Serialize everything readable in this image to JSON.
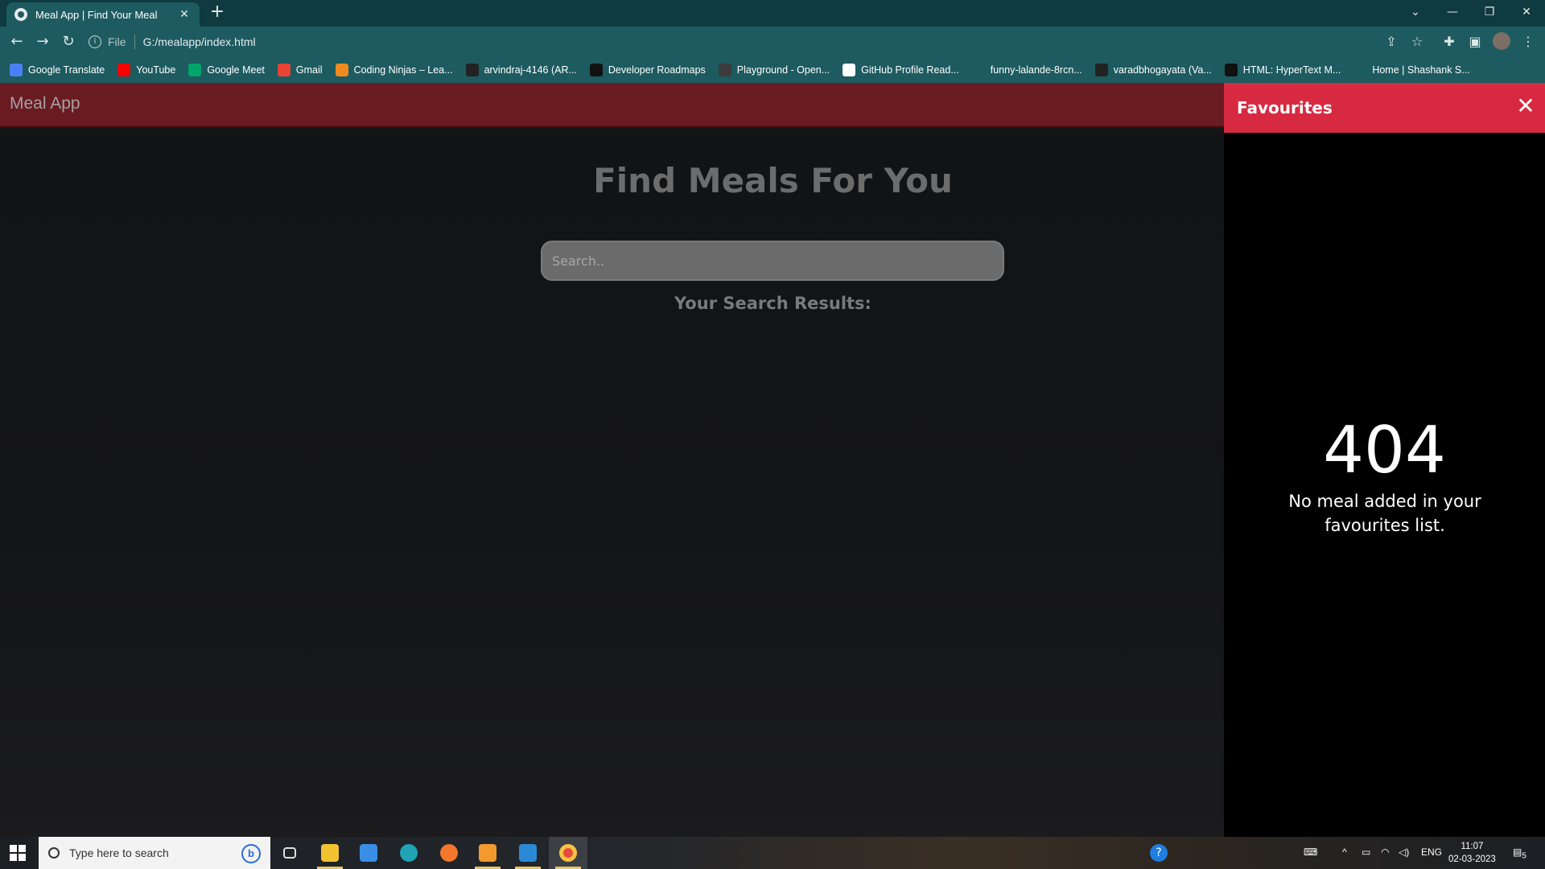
{
  "browser": {
    "tab_title": "Meal App | Find Your Meal",
    "tab_close": "✕",
    "new_tab": "+",
    "file_label": "File",
    "url": "G:/mealapp/index.html",
    "win_minimize": "—",
    "win_restore": "❐",
    "win_close": "✕",
    "bookmarks": [
      {
        "label": "Google Translate",
        "color": "#4a80f5"
      },
      {
        "label": "YouTube",
        "color": "#ff0000"
      },
      {
        "label": "Google Meet",
        "color": "#00a568"
      },
      {
        "label": "Gmail",
        "color": "#ea4335"
      },
      {
        "label": "Coding Ninjas – Lea...",
        "color": "#f08b20"
      },
      {
        "label": "arvindraj-4146 (AR...",
        "color": "#222222"
      },
      {
        "label": "Developer Roadmaps",
        "color": "#111111"
      },
      {
        "label": "Playground - Open...",
        "color": "#3b3b3b"
      },
      {
        "label": "GitHub Profile Read...",
        "color": "#ffffff"
      },
      {
        "label": "funny-lalande-8rcn...",
        "color": "#1d5b60"
      },
      {
        "label": "varadbhogayata (Va...",
        "color": "#222222"
      },
      {
        "label": "HTML: HyperText M...",
        "color": "#111111"
      },
      {
        "label": "Home | Shashank S...",
        "color": "#1d5b60"
      }
    ]
  },
  "app": {
    "brand": "Meal App",
    "heading": "Find Meals For You",
    "search_placeholder": "Search..",
    "results_label": "Your Search Results:"
  },
  "favourites": {
    "title": "Favourites",
    "close": "✕",
    "error_code": "404",
    "message": "No meal added in your favourites list."
  },
  "taskbar": {
    "search_placeholder": "Type here to search",
    "bing": "b",
    "language": "ENG",
    "time": "11:07",
    "date": "02-03-2023",
    "notifications": "5"
  },
  "colors": {
    "tab_strip": "#0f3a3f",
    "toolbar": "#1d5b60",
    "navbar": "#6a1b22",
    "fav_header": "#d72a41"
  }
}
